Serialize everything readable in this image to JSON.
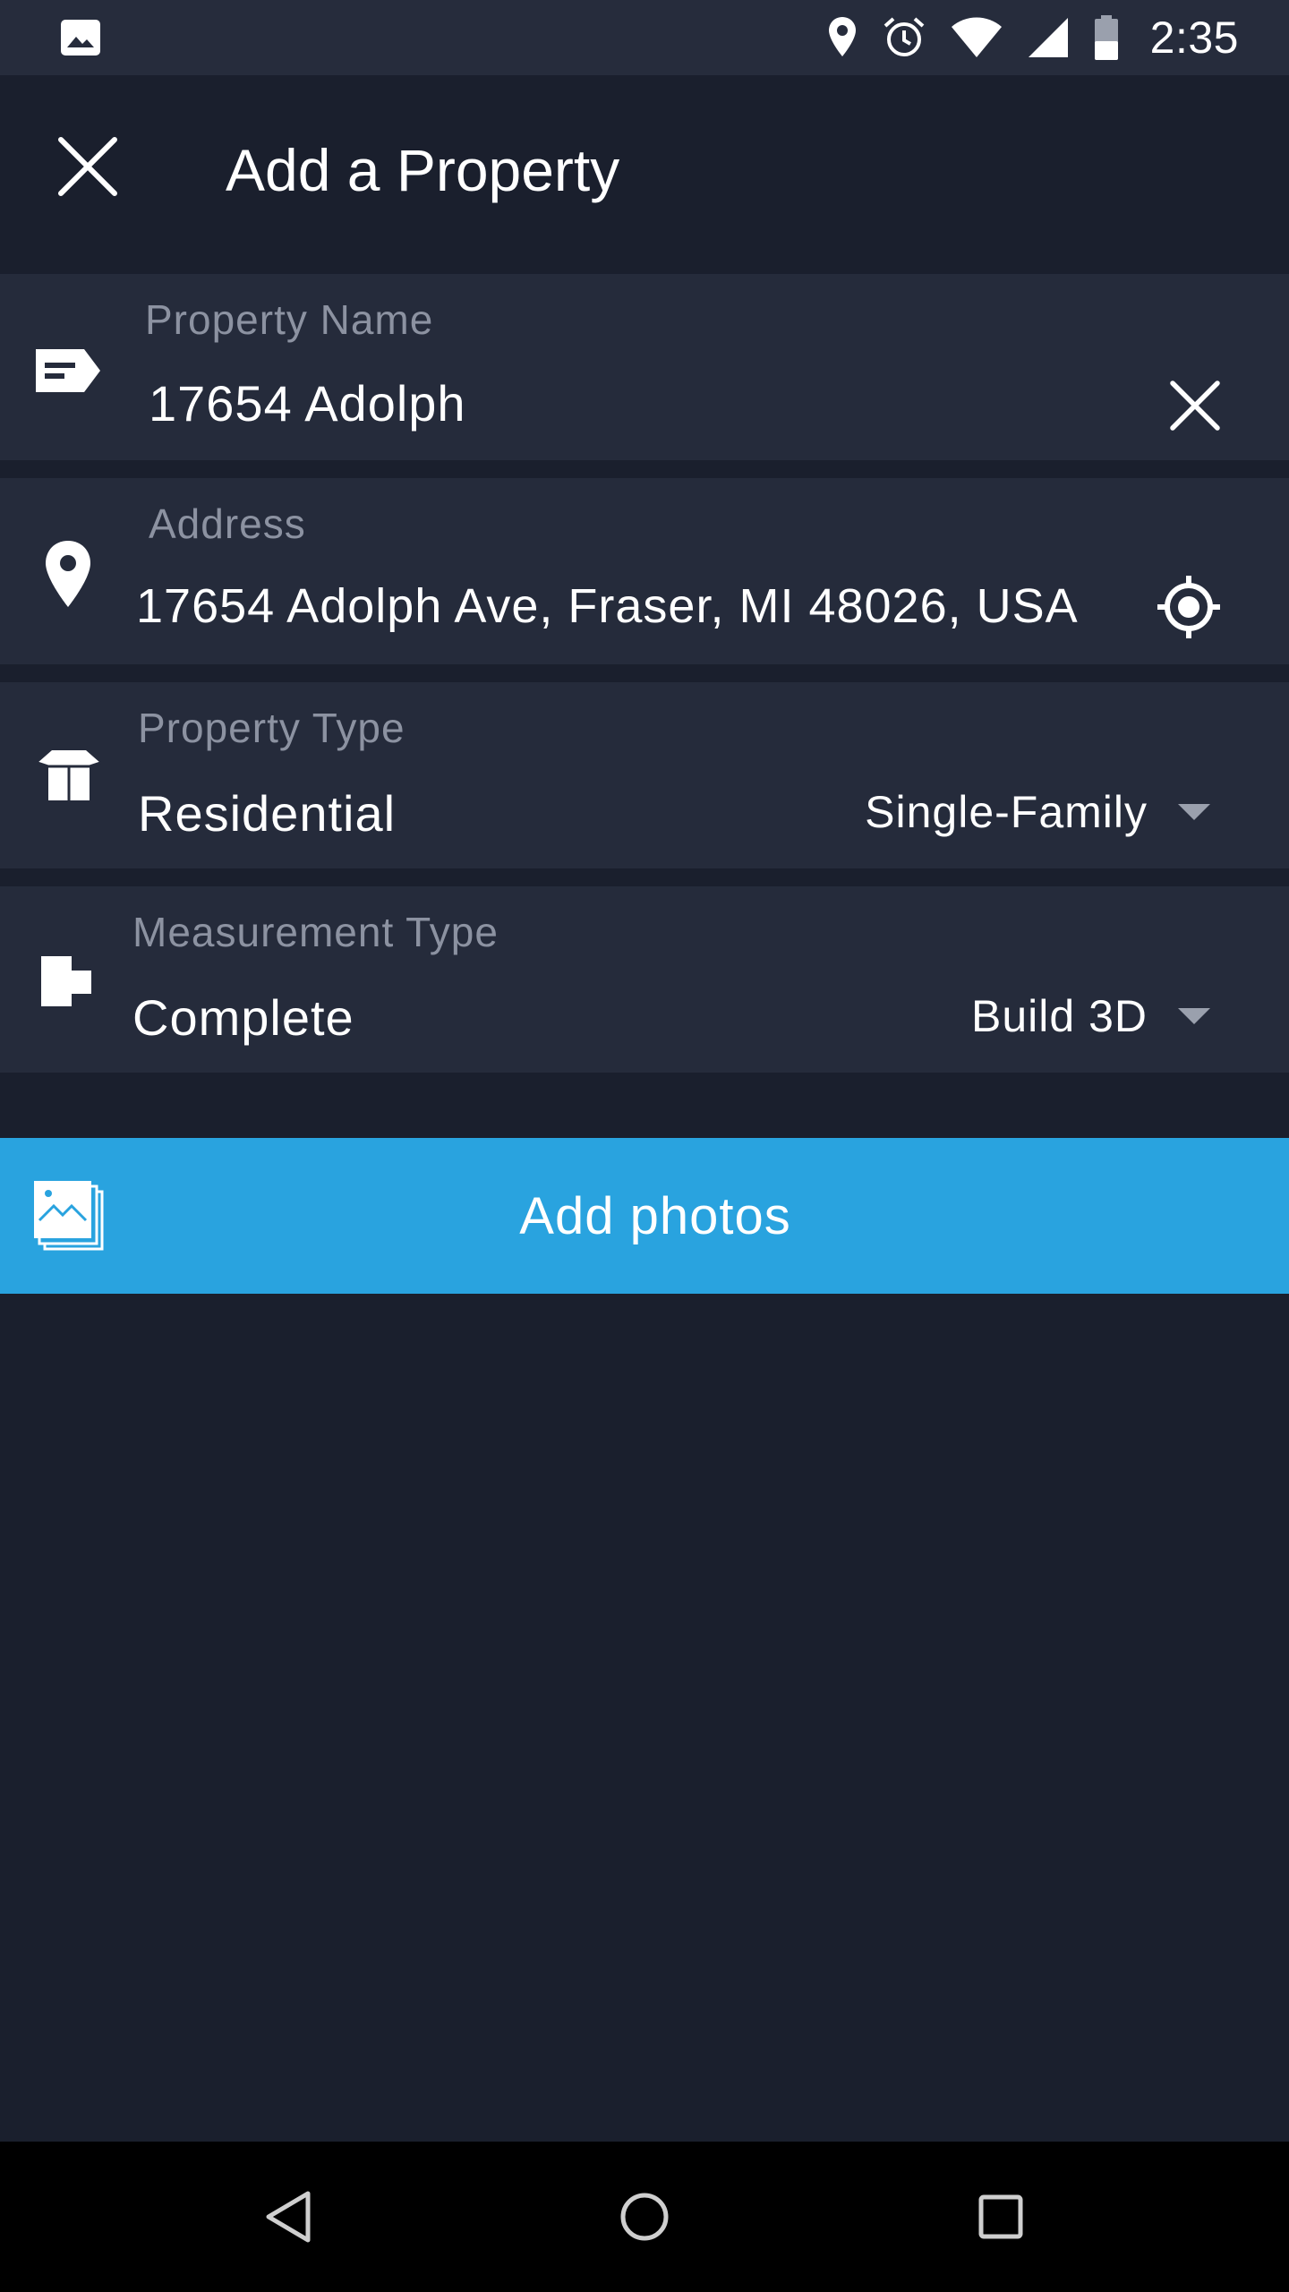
{
  "status_bar": {
    "time": "2:35",
    "left_icon": "image-notification-icon",
    "icons": [
      "location-icon",
      "alarm-icon",
      "wifi-icon",
      "signal-icon",
      "battery-icon"
    ]
  },
  "app_bar": {
    "title": "Add a Property",
    "close_icon": "close-icon"
  },
  "form": {
    "property_name": {
      "label": "Property Name",
      "value": "17654 Adolph",
      "icon": "label-tag-icon",
      "action_icon": "clear-icon"
    },
    "address": {
      "label": "Address",
      "value": "17654 Adolph Ave, Fraser, MI 48026, USA",
      "icon": "location-pin-icon",
      "action_icon": "gps-target-icon"
    },
    "property_type": {
      "label": "Property Type",
      "value": "Residential",
      "selected": "Single-Family",
      "icon": "open-box-icon"
    },
    "measurement_type": {
      "label": "Measurement Type",
      "value": "Complete",
      "selected": "Build 3D",
      "icon": "floorplan-icon"
    }
  },
  "add_photos": {
    "label": "Add photos",
    "icon": "photo-gallery-icon"
  },
  "nav_bar": {
    "buttons": [
      "back-icon",
      "home-icon",
      "recents-icon"
    ]
  },
  "colors": {
    "background": "#1a1f2d",
    "row": "#252b3b",
    "status_bar": "#262c3c",
    "accent": "#29a3df",
    "label": "#8c92a1"
  }
}
